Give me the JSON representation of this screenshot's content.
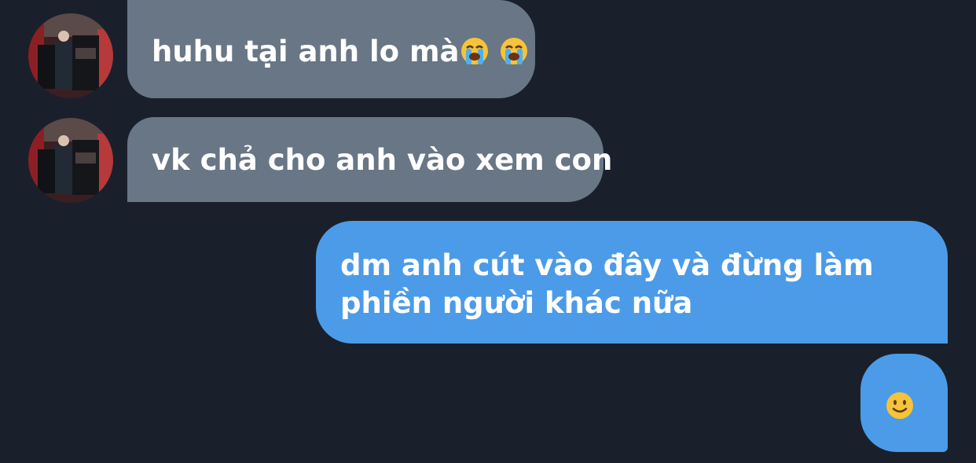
{
  "messages": [
    {
      "sender": "other",
      "text": "huhu tại anh lo mà",
      "emojis": [
        "loudly-crying-face-emoji",
        "loudly-crying-face-emoji"
      ]
    },
    {
      "sender": "other",
      "text": "vk chả cho anh vào xem con"
    },
    {
      "sender": "me",
      "line1": "dm anh cút vào đây và đừng làm",
      "line2": "phiền người khác nữa"
    },
    {
      "sender": "me",
      "emoji": "slightly-smiling-face-emoji"
    }
  ],
  "colors": {
    "background": "#1a202b",
    "incoming_bubble": "#687686",
    "outgoing_bubble": "#4c9be8",
    "text": "#ffffff"
  }
}
